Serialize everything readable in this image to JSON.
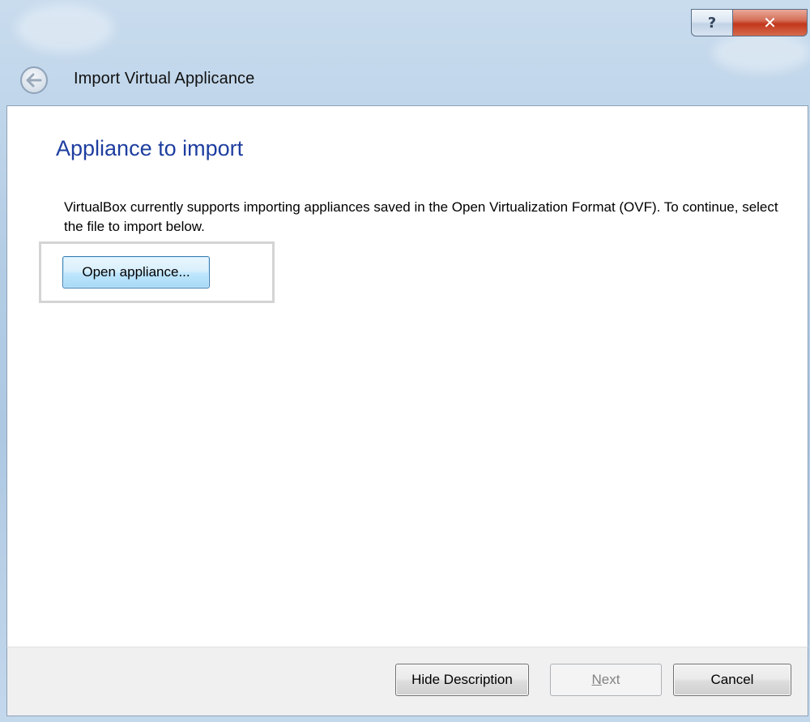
{
  "window": {
    "title": "Import Virtual Applicance",
    "help_label": "?",
    "close_label": "✕"
  },
  "page": {
    "heading": "Appliance to import",
    "description": "VirtualBox currently supports importing appliances saved in the Open Virtualization Format (OVF). To continue, select the file to import below.",
    "open_button_label": "Open appliance..."
  },
  "footer": {
    "hide_description_label": "Hide Description",
    "next_mnemonic": "N",
    "next_rest": "ext",
    "next_enabled": false,
    "cancel_label": "Cancel"
  },
  "icons": {
    "back": "back-arrow-icon",
    "help": "help-icon",
    "close": "close-icon"
  },
  "colors": {
    "heading": "#1e3ea0",
    "close_button": "#c2371c",
    "glass": "#b4cde5",
    "focus_button": "#bee6fd"
  }
}
